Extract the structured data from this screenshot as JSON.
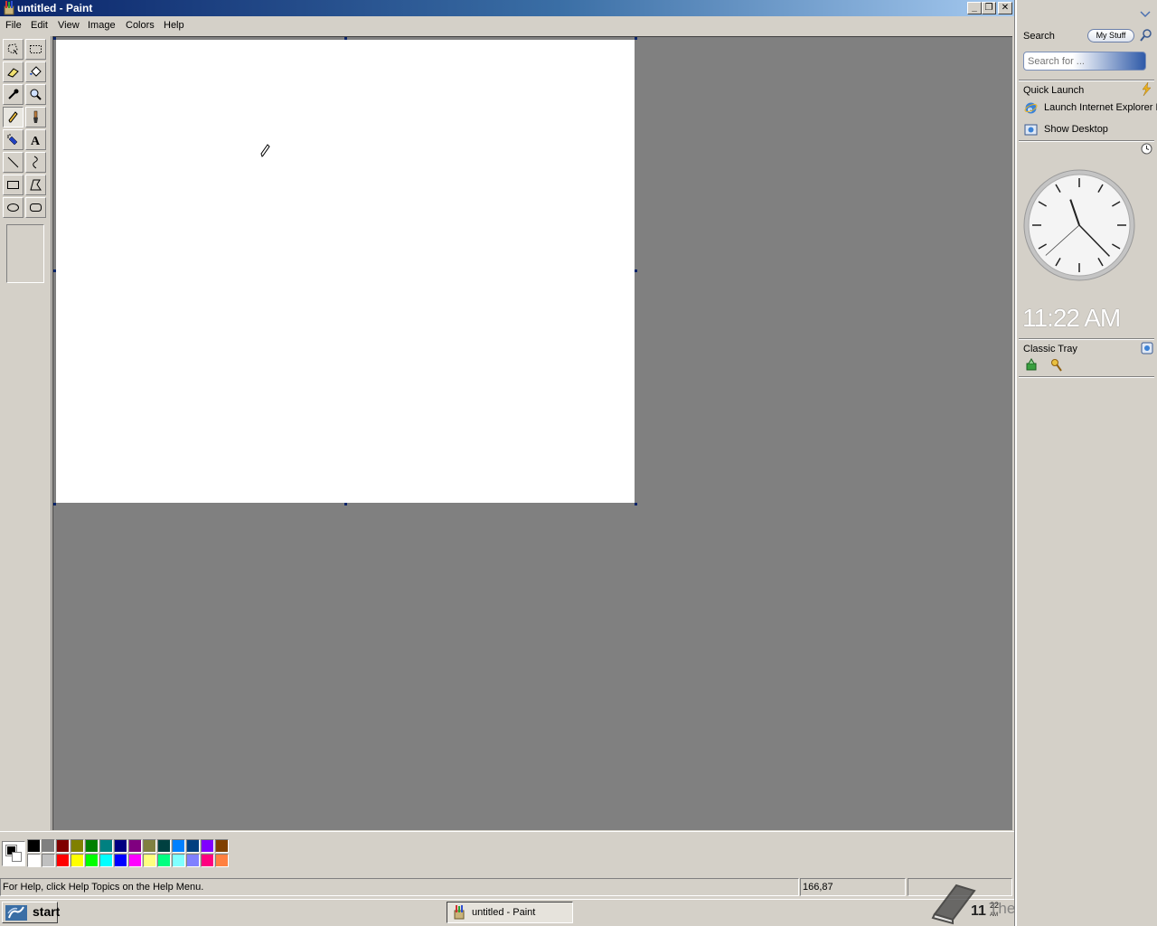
{
  "window": {
    "title": "untitled - Paint"
  },
  "menu": [
    "File",
    "Edit",
    "View",
    "Image",
    "Colors",
    "Help"
  ],
  "tools": [
    "free-form-select",
    "select",
    "eraser",
    "fill-with-color",
    "pick-color",
    "magnifier",
    "pencil",
    "brush",
    "airbrush",
    "text",
    "line",
    "curve",
    "rectangle",
    "polygon",
    "ellipse",
    "rounded-rectangle"
  ],
  "active_tool": "pencil",
  "palette": {
    "top": [
      "#000000",
      "#808080",
      "#800000",
      "#808000",
      "#008000",
      "#008080",
      "#000080",
      "#800080",
      "#808040",
      "#004040",
      "#0080ff",
      "#004080",
      "#8000ff",
      "#804000"
    ],
    "bottom": [
      "#ffffff",
      "#c0c0c0",
      "#ff0000",
      "#ffff00",
      "#00ff00",
      "#00ffff",
      "#0000ff",
      "#ff00ff",
      "#ffff80",
      "#00ff80",
      "#80ffff",
      "#8080ff",
      "#ff0080",
      "#ff8040"
    ]
  },
  "status": {
    "help_text": "For Help, click Help Topics on the Help Menu.",
    "coords": "166,87",
    "size": ""
  },
  "taskbar": {
    "start_label": "start",
    "task_label": "untitled - Paint",
    "clock_hour": "11",
    "clock_min": "22",
    "clock_ampm": "AM"
  },
  "watermark": "The Collection Book",
  "sidebar": {
    "search_title": "Search",
    "my_stuff": "My Stuff",
    "search_placeholder": "Search for ...",
    "quick_launch_title": "Quick Launch",
    "quick_launch_items": [
      "Launch Internet Explorer Browser",
      "Show Desktop"
    ],
    "digital_time": "11:22 AM",
    "classic_tray_title": "Classic Tray"
  },
  "clock": {
    "hour": 11,
    "minute": 22,
    "second": 38
  }
}
